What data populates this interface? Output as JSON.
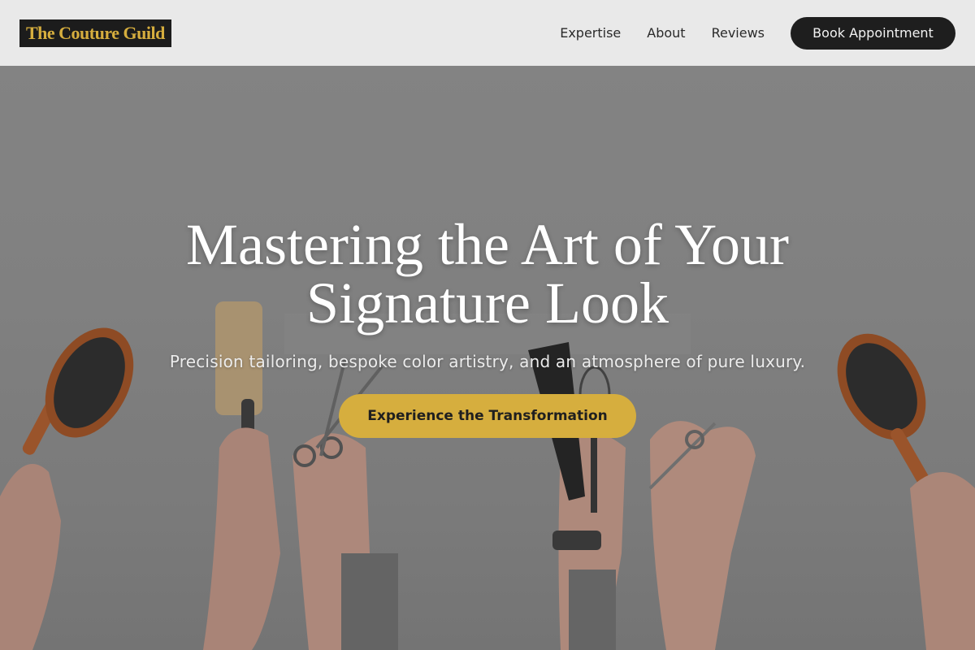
{
  "brand": {
    "name": "The Couture Guild"
  },
  "nav": {
    "links": [
      {
        "label": "Expertise"
      },
      {
        "label": "About"
      },
      {
        "label": "Reviews"
      }
    ],
    "cta_label": "Book Appointment"
  },
  "hero": {
    "title": "Mastering the Art of Your Signature Look",
    "subtitle": "Precision tailoring, bespoke color artistry, and an atmosphere of pure luxury.",
    "cta_label": "Experience the Transformation",
    "background": "raised hands holding hair brushes, scissors, comb and whisk against a light wall"
  },
  "colors": {
    "accent_gold": "#d6ae3e",
    "dark": "#1e1e1e",
    "nav_bg": "#e9e9e9"
  }
}
